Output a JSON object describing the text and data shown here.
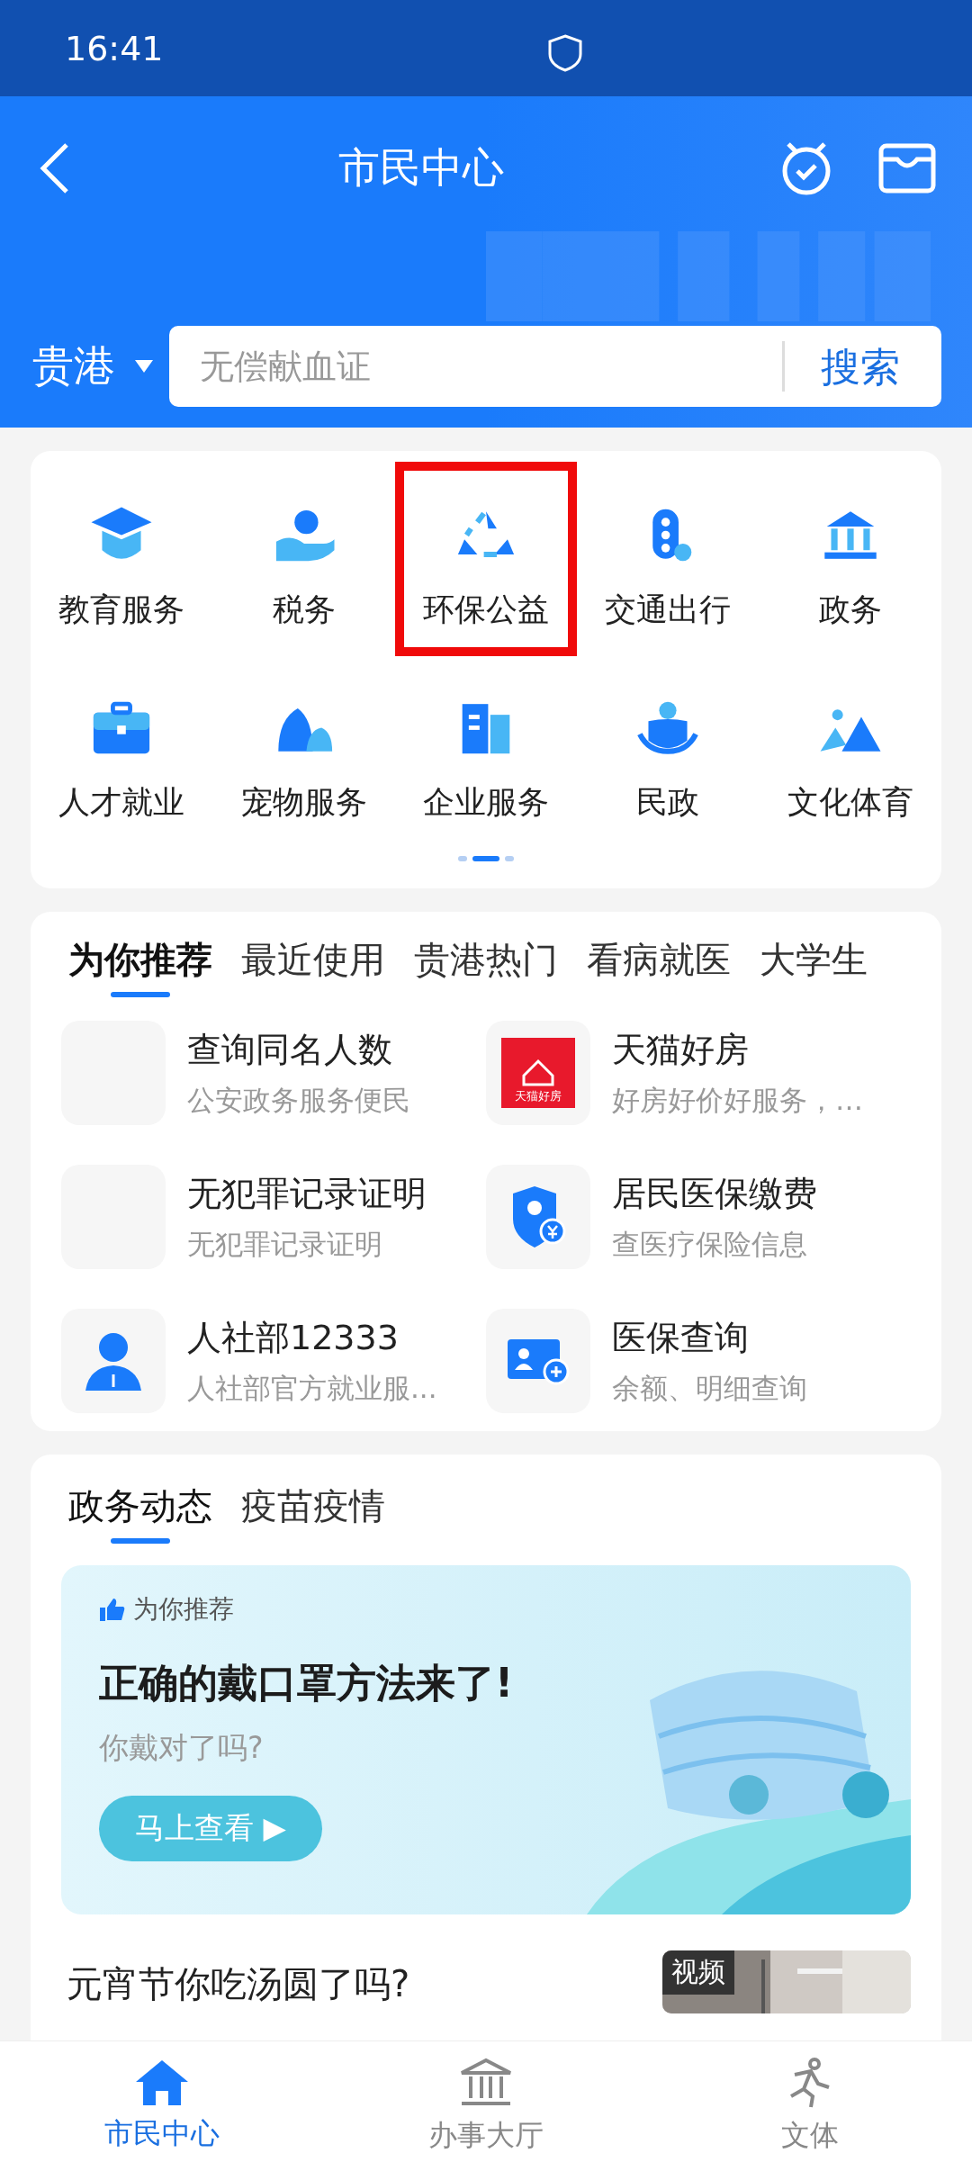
{
  "status_bar": {
    "time": "16:41"
  },
  "header": {
    "title": "市民中心",
    "city": "贵港",
    "search": {
      "placeholder": "无偿献血证",
      "button": "搜索"
    }
  },
  "services": [
    {
      "label": "教育服务",
      "highlighted": false
    },
    {
      "label": "税务",
      "highlighted": false
    },
    {
      "label": "环保公益",
      "highlighted": true
    },
    {
      "label": "交通出行",
      "highlighted": false
    },
    {
      "label": "政务",
      "highlighted": false
    },
    {
      "label": "人才就业",
      "highlighted": false
    },
    {
      "label": "宠物服务",
      "highlighted": false
    },
    {
      "label": "企业服务",
      "highlighted": false
    },
    {
      "label": "民政",
      "highlighted": false
    },
    {
      "label": "文化体育",
      "highlighted": false
    }
  ],
  "pager": [
    {
      "selected": false
    },
    {
      "selected": true
    },
    {
      "selected": false
    }
  ],
  "recommend": {
    "tabs": [
      {
        "label": "为你推荐",
        "selected": true
      },
      {
        "label": "最近使用",
        "selected": false
      },
      {
        "label": "贵港热门",
        "selected": false
      },
      {
        "label": "看病就医",
        "selected": false
      },
      {
        "label": "大学生",
        "selected": false
      }
    ],
    "items": [
      {
        "kind": "blank",
        "title": "查询同名人数",
        "subtitle": "公安政务服务便民"
      },
      {
        "kind": "logo",
        "title": "天猫好房",
        "subtitle": "好房好价好服务，…",
        "logo_text": "天猫好房"
      },
      {
        "kind": "blank",
        "title": "无犯罪记录证明",
        "subtitle": "无犯罪记录证明"
      },
      {
        "kind": "shield",
        "title": "居民医保缴费",
        "subtitle": "查医疗保险信息"
      },
      {
        "kind": "person",
        "title": "人社部12333",
        "subtitle": "人社部官方就业服..."
      },
      {
        "kind": "card",
        "title": "医保查询",
        "subtitle": "余额、明细查询"
      }
    ]
  },
  "news": {
    "tabs": [
      {
        "label": "政务动态",
        "selected": true
      },
      {
        "label": "疫苗疫情",
        "selected": false
      }
    ],
    "banner": {
      "tag": "为你推荐",
      "title": "正确的戴口罩方法来了!",
      "subtitle": "你戴对了吗?",
      "button": "马上查看 ▶"
    },
    "article": {
      "title": "元宵节你吃汤圆了吗?",
      "badge": "视频"
    }
  },
  "bottom_nav": [
    {
      "label": "市民中心",
      "selected": true
    },
    {
      "label": "办事大厅",
      "selected": false
    },
    {
      "label": "文体",
      "selected": false
    }
  ]
}
